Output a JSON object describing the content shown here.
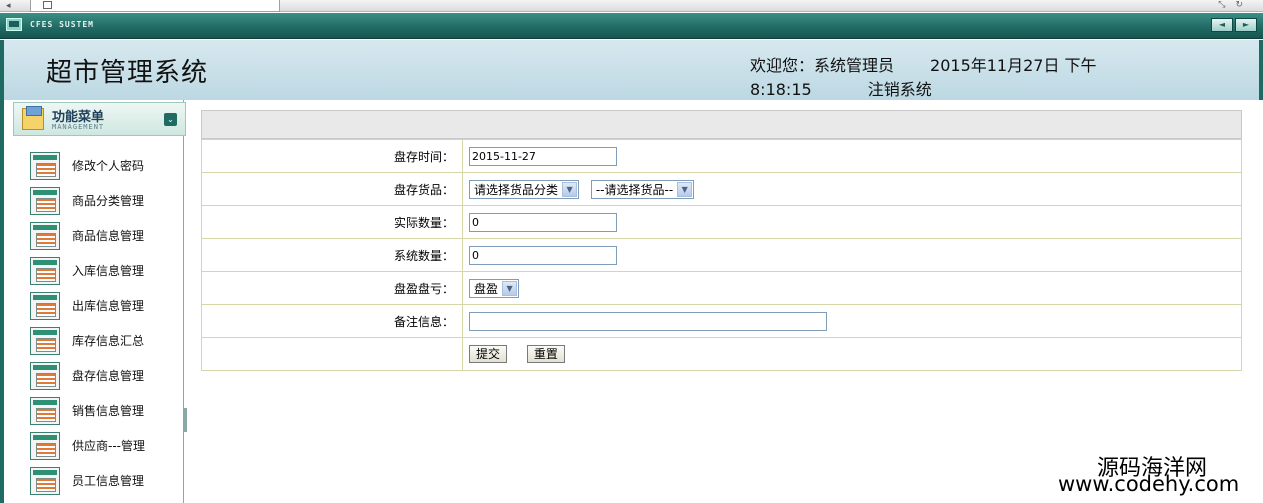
{
  "window": {
    "system_label": "CFES SUSTEM",
    "arrow_left": "◄",
    "arrow_right": "►"
  },
  "header": {
    "app_title": "超市管理系统",
    "welcome_prefix": "欢迎您：",
    "user": "系统管理员",
    "datetime_line1": "2015年11月27日 下午",
    "datetime_line2": "8:18:15",
    "logout": "注销系统"
  },
  "sidebar": {
    "title": "功能菜单",
    "subtitle": "MANAGEMENT",
    "toggle_icon": "chevron-double-down-icon",
    "items": [
      {
        "label": "修改个人密码",
        "icon": "doc-icon"
      },
      {
        "label": "商品分类管理",
        "icon": "doc-icon"
      },
      {
        "label": "商品信息管理",
        "icon": "doc-icon"
      },
      {
        "label": "入库信息管理",
        "icon": "doc-icon"
      },
      {
        "label": "出库信息管理",
        "icon": "doc-icon"
      },
      {
        "label": "库存信息汇总",
        "icon": "doc-icon"
      },
      {
        "label": "盘存信息管理",
        "icon": "doc-icon"
      },
      {
        "label": "销售信息管理",
        "icon": "doc-icon"
      },
      {
        "label": "供应商---管理",
        "icon": "doc-icon"
      },
      {
        "label": "员工信息管理",
        "icon": "doc-icon"
      }
    ]
  },
  "form": {
    "inventory_time": {
      "label": "盘存时间：",
      "value": "2015-11-27"
    },
    "goods": {
      "label": "盘存货品：",
      "category_selected": "请选择货品分类",
      "goods_selected": "--请选择货品--"
    },
    "actual_qty": {
      "label": "实际数量：",
      "value": "0"
    },
    "system_qty": {
      "label": "系统数量：",
      "value": "0"
    },
    "profit_loss": {
      "label": "盘盈盘亏：",
      "selected": "盘盈"
    },
    "remarks": {
      "label": "备注信息：",
      "value": ""
    },
    "submit_label": "提交",
    "reset_label": "重置"
  },
  "watermark": {
    "line1": "源码海洋网",
    "line2": "www.codehy.com"
  },
  "colors": {
    "titlebar": "#1f6a63",
    "header_bg": "#c8e0e8",
    "table_border": "#d6d7a8"
  }
}
